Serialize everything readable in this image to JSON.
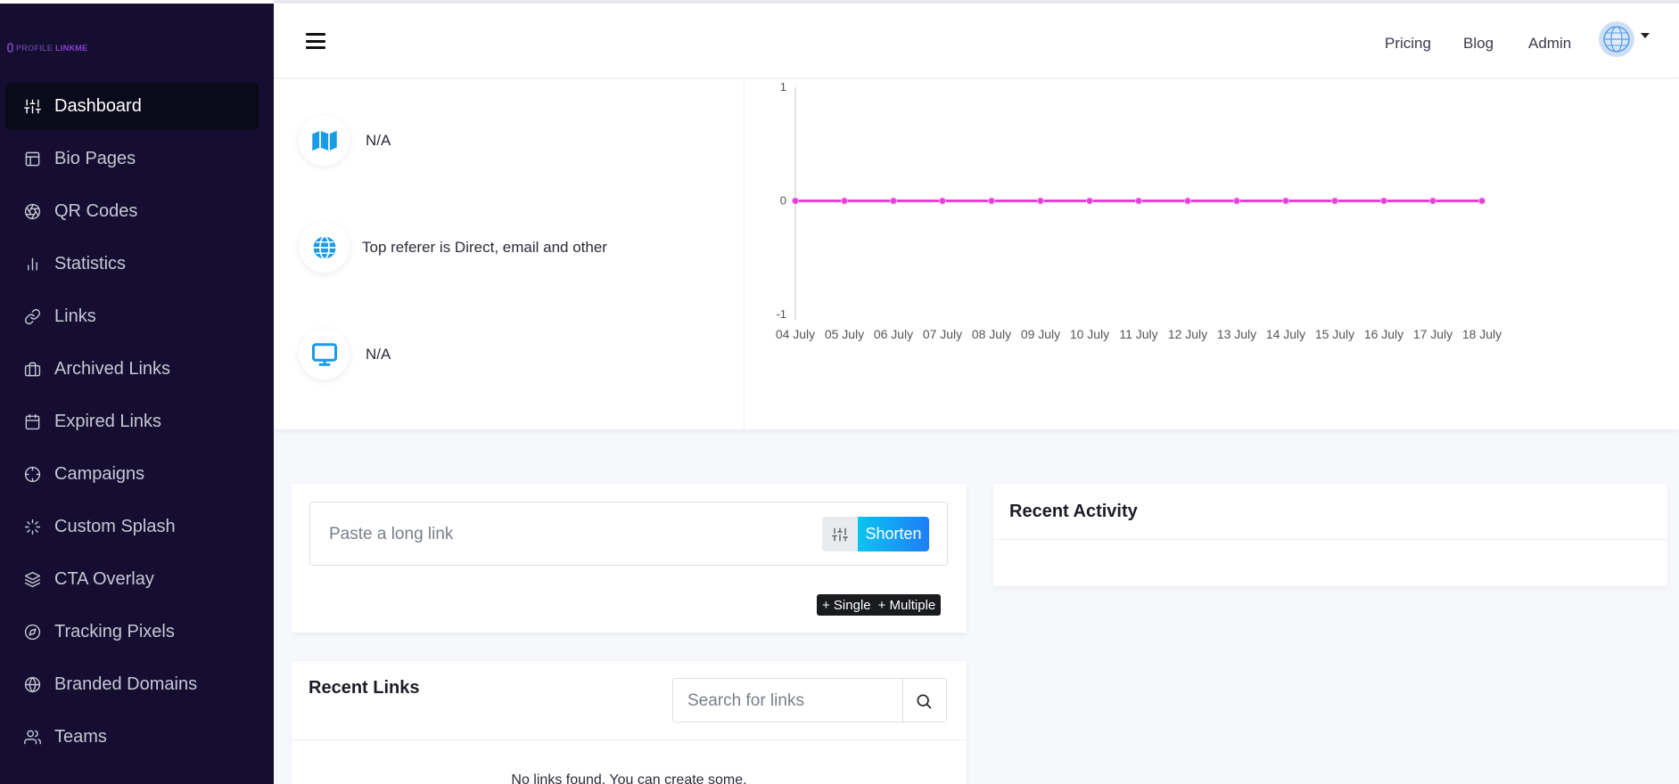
{
  "brand": {
    "name_part1": "PROFILE",
    "name_part2": "LINKME"
  },
  "sidebar": {
    "items": [
      {
        "label": "Dashboard",
        "icon": "sliders-icon",
        "active": true
      },
      {
        "label": "Bio Pages",
        "icon": "layout-icon"
      },
      {
        "label": "QR Codes",
        "icon": "aperture-icon"
      },
      {
        "label": "Statistics",
        "icon": "bar-chart-icon"
      },
      {
        "label": "Links",
        "icon": "link-icon"
      },
      {
        "label": "Archived Links",
        "icon": "briefcase-icon"
      },
      {
        "label": "Expired Links",
        "icon": "calendar-icon"
      },
      {
        "label": "Campaigns",
        "icon": "crosshair-icon"
      },
      {
        "label": "Custom Splash",
        "icon": "loader-icon"
      },
      {
        "label": "CTA Overlay",
        "icon": "layers-icon"
      },
      {
        "label": "Tracking Pixels",
        "icon": "compass-icon"
      },
      {
        "label": "Branded Domains",
        "icon": "globe-icon"
      },
      {
        "label": "Teams",
        "icon": "users-icon"
      }
    ]
  },
  "header": {
    "nav": {
      "pricing": "Pricing",
      "blog": "Blog",
      "admin": "Admin"
    }
  },
  "stats": {
    "country": {
      "text": "N/A",
      "icon": "map-icon"
    },
    "referer": {
      "text": "Top referer is Direct, email and other",
      "icon": "globe-icon"
    },
    "device": {
      "text": "N/A",
      "icon": "monitor-icon"
    }
  },
  "chart_data": {
    "type": "line",
    "x": [
      "04 July",
      "05 July",
      "06 July",
      "07 July",
      "08 July",
      "09 July",
      "10 July",
      "11 July",
      "12 July",
      "13 July",
      "14 July",
      "15 July",
      "16 July",
      "17 July",
      "18 July"
    ],
    "series": [
      {
        "values": [
          0,
          0,
          0,
          0,
          0,
          0,
          0,
          0,
          0,
          0,
          0,
          0,
          0,
          0,
          0
        ]
      }
    ],
    "ylim": [
      -1,
      1
    ],
    "yticks": [
      "1",
      "0",
      "-1"
    ],
    "color": "#e43fd6",
    "grid": false
  },
  "shorten": {
    "placeholder": "Paste a long link",
    "button": "Shorten",
    "single": "+ Single",
    "multiple": "+ Multiple"
  },
  "recent_links": {
    "title": "Recent Links",
    "search_placeholder": "Search for links",
    "empty_text": "No links found. You can create some."
  },
  "recent_activity": {
    "title": "Recent Activity"
  },
  "colors": {
    "sidebar_bg": "#150e30",
    "accent": "#1e7ef7",
    "chart_line": "#e43fd6",
    "stat_icon": "#1a9be6"
  }
}
